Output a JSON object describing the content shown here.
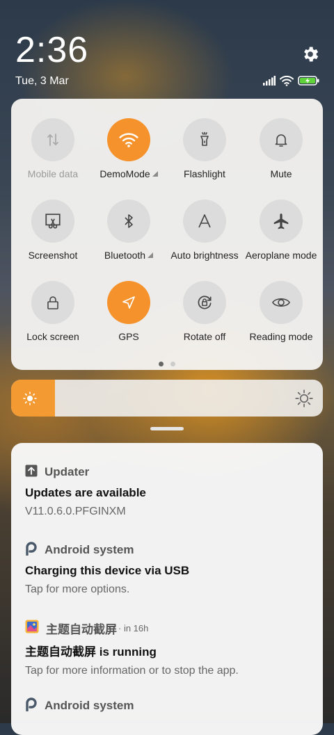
{
  "status": {
    "time": "2:36",
    "date": "Tue, 3 Mar"
  },
  "icons": {
    "settings": "gear-icon",
    "signal": "signal-icon",
    "wifi": "wifi-icon",
    "battery": "battery-charging-icon"
  },
  "colors": {
    "accent": "#f5922b",
    "tile_off": "#dcdcdc"
  },
  "quick_settings": {
    "tiles": [
      {
        "label": "Mobile data",
        "state": "disabled",
        "icon": "mobile-data-icon"
      },
      {
        "label": "DemoMode",
        "state": "on",
        "icon": "wifi-icon",
        "expandable": true
      },
      {
        "label": "Flashlight",
        "state": "off",
        "icon": "flashlight-icon"
      },
      {
        "label": "Mute",
        "state": "off",
        "icon": "bell-icon"
      },
      {
        "label": "Screenshot",
        "state": "off",
        "icon": "screenshot-icon"
      },
      {
        "label": "Bluetooth",
        "state": "off",
        "icon": "bluetooth-icon",
        "expandable": true
      },
      {
        "label": "Auto brightness",
        "state": "off",
        "icon": "auto-brightness-icon"
      },
      {
        "label": "Aeroplane mode",
        "state": "off",
        "icon": "airplane-icon"
      },
      {
        "label": "Lock screen",
        "state": "off",
        "icon": "lock-icon"
      },
      {
        "label": "GPS",
        "state": "on",
        "icon": "location-icon"
      },
      {
        "label": "Rotate off",
        "state": "off",
        "icon": "rotate-lock-icon"
      },
      {
        "label": "Reading mode",
        "state": "off",
        "icon": "eye-icon"
      }
    ],
    "page_count": 2,
    "active_page": 1
  },
  "brightness": {
    "level": 0.14
  },
  "notifications": [
    {
      "app": "Updater",
      "title": "Updates are available",
      "text": "V11.0.6.0.PFGINXM",
      "icon": "upload-arrow-icon"
    },
    {
      "app": "Android system",
      "title": "Charging this device via USB",
      "text": "Tap for more options.",
      "icon": "android-system-icon"
    },
    {
      "app": "主题自动截屏",
      "time": "in 16h",
      "title": "主题自动截屏 is running",
      "text": "Tap for more information or to stop the app.",
      "icon": "app-theme-icon"
    },
    {
      "app": "Android system",
      "icon": "android-system-icon"
    }
  ]
}
